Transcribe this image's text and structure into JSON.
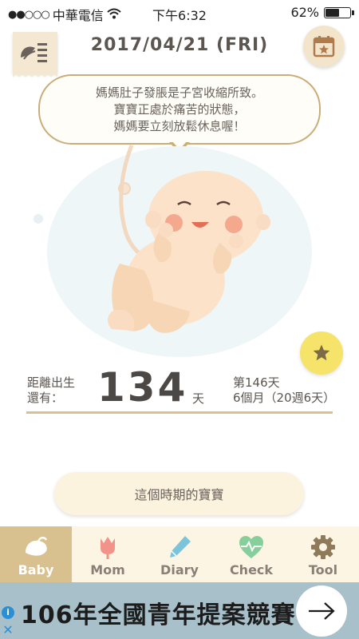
{
  "status_bar": {
    "carrier": "中華電信",
    "time": "下午6:32",
    "battery": "62%",
    "battery_level": 0.62
  },
  "header": {
    "date": "2017/04/21 (FRI)",
    "menu_icon": "sprout-list-icon",
    "calendar_icon": "calendar-star-icon"
  },
  "message": {
    "line1": "媽媽肚子發脹是子宮收縮所致。",
    "line2": "寶寶正處於痛苦的狀態，",
    "line3": "媽媽要立刻放鬆休息喔！"
  },
  "countdown": {
    "label_line1": "距離出生",
    "label_line2": "還有：",
    "days": "134",
    "unit": "天",
    "day_index": "第146天",
    "months_weeks": "6個月（20週6天）"
  },
  "period_button": {
    "label": "這個時期的寶寶"
  },
  "tabs": [
    {
      "label": "Baby",
      "icon": "baby-icon",
      "active": true
    },
    {
      "label": "Mom",
      "icon": "tulip-icon",
      "active": false
    },
    {
      "label": "Diary",
      "icon": "pen-icon",
      "active": false
    },
    {
      "label": "Check",
      "icon": "heartbeat-icon",
      "active": false
    },
    {
      "label": "Tool",
      "icon": "gear-icon",
      "active": false
    }
  ],
  "ad": {
    "text": "106年全國青年提案競賽",
    "info_icon": "info-icon",
    "close_icon": "close-icon",
    "arrow_icon": "arrow-right-icon"
  },
  "colors": {
    "accent_gold": "#d8c08f",
    "tab_bg": "#fdf5e4",
    "bubble_border": "#c9ae7a",
    "star_button": "#f5e36a",
    "ad_bg": "#a7c0c9"
  }
}
